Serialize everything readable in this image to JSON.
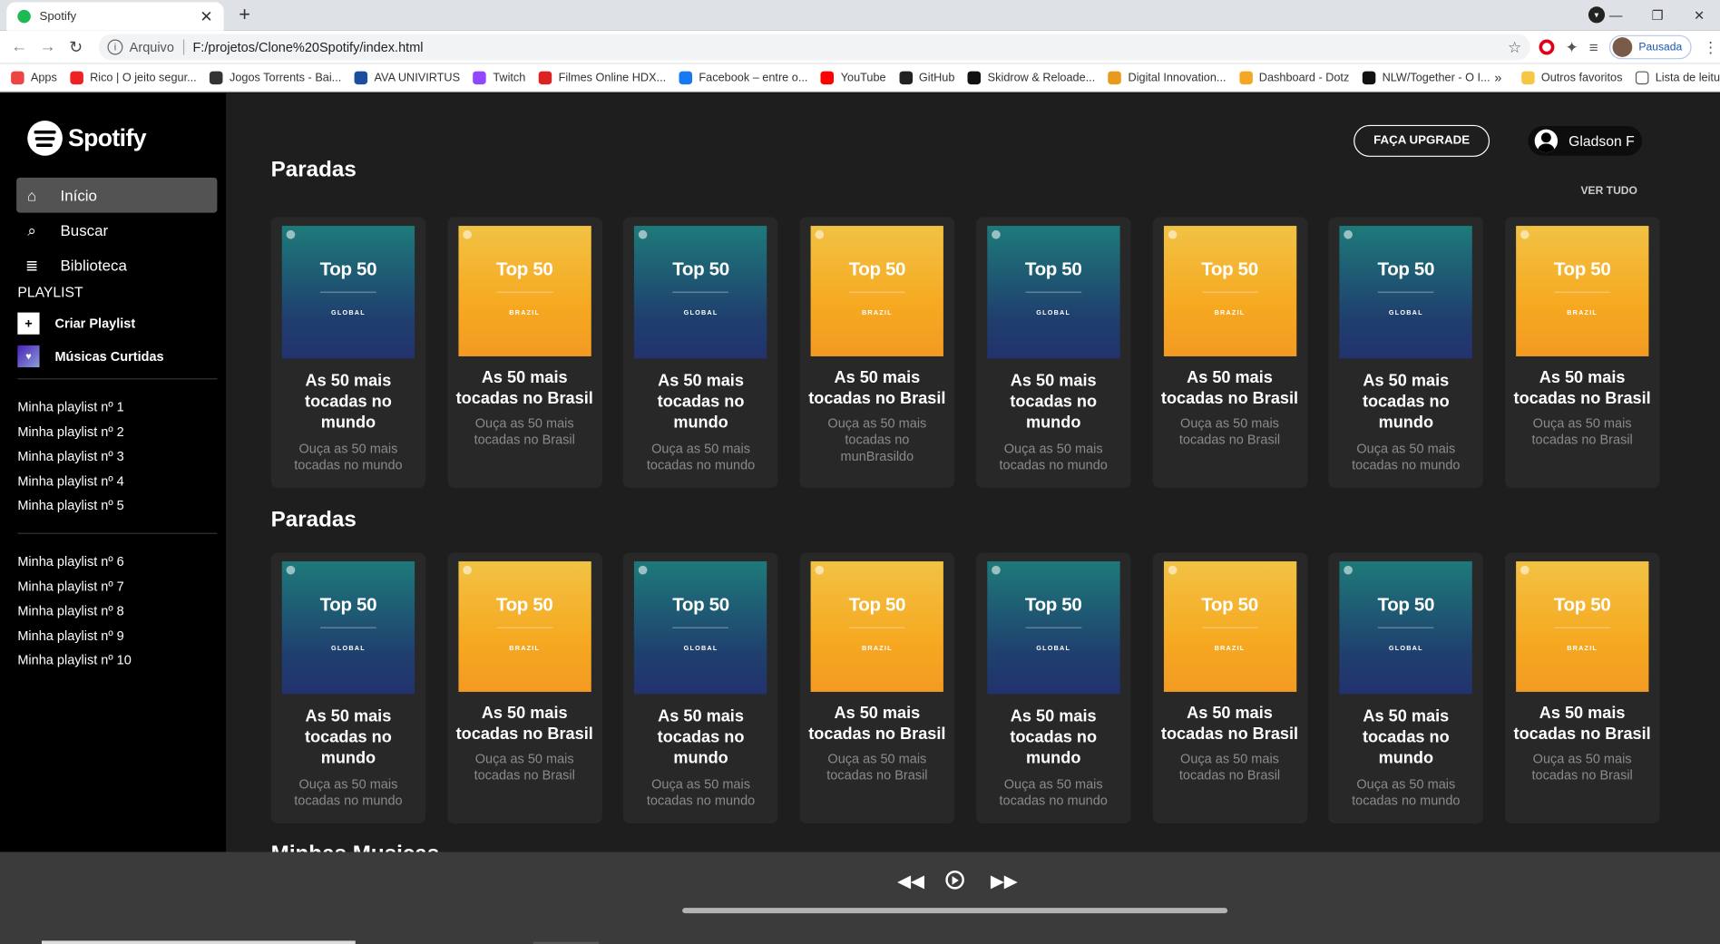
{
  "browser": {
    "tab_title": "Spotify",
    "address_prefix": "Arquivo",
    "url": "F:/projetos/Clone%20Spotify/index.html",
    "profile_status": "Pausada",
    "bookmarks": [
      {
        "label": "Apps",
        "color": "#e44"
      },
      {
        "label": "Rico | O jeito segur...",
        "color": "#e22"
      },
      {
        "label": "Jogos Torrents - Bai...",
        "color": "#333"
      },
      {
        "label": "AVA UNIVIRTUS",
        "color": "#1a4fa0"
      },
      {
        "label": "Twitch",
        "color": "#9146ff"
      },
      {
        "label": "Filmes Online HDX...",
        "color": "#d22"
      },
      {
        "label": "Facebook – entre o...",
        "color": "#1877f2"
      },
      {
        "label": "YouTube",
        "color": "#f00"
      },
      {
        "label": "GitHub",
        "color": "#222"
      },
      {
        "label": "Skidrow & Reloade...",
        "color": "#111"
      },
      {
        "label": "Digital Innovation...",
        "color": "#e89a1c"
      },
      {
        "label": "Dashboard - Dotz",
        "color": "#f5a623"
      },
      {
        "label": "NLW/Together - O I...",
        "color": "#121214"
      }
    ],
    "bookmarks_more": "»",
    "other_bookmarks": "Outros favoritos",
    "reading_list": "Lista de leitu"
  },
  "sidebar": {
    "logo": "Spotify",
    "nav": [
      {
        "label": "Início",
        "icon": "home-icon"
      },
      {
        "label": "Buscar",
        "icon": "search-icon"
      },
      {
        "label": "Biblioteca",
        "icon": "library-icon"
      }
    ],
    "playlist_heading": "PLAYLIST",
    "create_playlist": "Criar Playlist",
    "liked_songs": "Músicas Curtidas",
    "playlists_a": [
      "Minha playlist nº 1",
      "Minha playlist nº 2",
      "Minha playlist nº 3",
      "Minha playlist nº 4",
      "Minha playlist nº 5"
    ],
    "playlists_b": [
      "Minha playlist nº 6",
      "Minha playlist nº 7",
      "Minha playlist nº 8",
      "Minha playlist nº 9",
      "Minha playlist nº 10"
    ]
  },
  "header": {
    "upgrade": "FAÇA UPGRADE",
    "user_name": "Gladson F"
  },
  "sections": [
    {
      "title": "Paradas",
      "see_all": "VER TUDO"
    },
    {
      "title": "Paradas"
    }
  ],
  "next_section_title": "Minhas Musicas",
  "cover": {
    "top": "Top 50",
    "global": "GLOBAL",
    "brazil": "BRAZIL"
  },
  "cards_row1": [
    {
      "title": "As 50 mais tocadas no mundo",
      "subtitle": "Ouça as 50 mais tocadas no mundo"
    },
    {
      "title": "As 50 mais tocadas no Brasil",
      "subtitle": "Ouça as 50 mais tocadas no Brasil"
    },
    {
      "title": "As 50 mais tocadas no mundo",
      "subtitle": "Ouça as 50 mais tocadas no mundo"
    },
    {
      "title": "As 50 mais tocadas no Brasil",
      "subtitle": "Ouça as 50 mais tocadas no munBrasildo"
    },
    {
      "title": "As 50 mais tocadas no mundo",
      "subtitle": "Ouça as 50 mais tocadas no mundo"
    },
    {
      "title": "As 50 mais tocadas no Brasil",
      "subtitle": "Ouça as 50 mais tocadas no Brasil"
    },
    {
      "title": "As 50 mais tocadas no mundo",
      "subtitle": "Ouça as 50 mais tocadas no mundo"
    },
    {
      "title": "As 50 mais tocadas no Brasil",
      "subtitle": "Ouça as 50 mais tocadas no Brasil"
    }
  ],
  "cards_row2": [
    {
      "title": "As 50 mais tocadas no mundo",
      "subtitle": "Ouça as 50 mais tocadas no mundo"
    },
    {
      "title": "As 50 mais tocadas no Brasil",
      "subtitle": "Ouça as 50 mais tocadas no Brasil"
    },
    {
      "title": "As 50 mais tocadas no mundo",
      "subtitle": "Ouça as 50 mais tocadas no mundo"
    },
    {
      "title": "As 50 mais tocadas no Brasil",
      "subtitle": "Ouça as 50 mais tocadas no Brasil"
    },
    {
      "title": "As 50 mais tocadas no mundo",
      "subtitle": "Ouça as 50 mais tocadas no mundo"
    },
    {
      "title": "As 50 mais tocadas no Brasil",
      "subtitle": "Ouça as 50 mais tocadas no Brasil"
    },
    {
      "title": "As 50 mais tocadas no mundo",
      "subtitle": "Ouça as 50 mais tocadas no mundo"
    },
    {
      "title": "As 50 mais tocadas no Brasil",
      "subtitle": "Ouça as 50 mais tocadas no Brasil"
    }
  ]
}
